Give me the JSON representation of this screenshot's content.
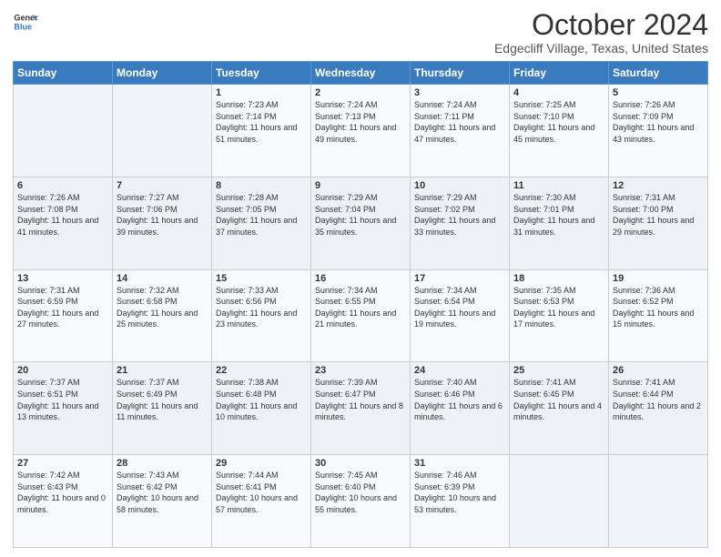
{
  "header": {
    "logo_line1": "General",
    "logo_line2": "Blue",
    "title": "October 2024",
    "subtitle": "Edgecliff Village, Texas, United States"
  },
  "days_of_week": [
    "Sunday",
    "Monday",
    "Tuesday",
    "Wednesday",
    "Thursday",
    "Friday",
    "Saturday"
  ],
  "weeks": [
    [
      {
        "day": "",
        "info": ""
      },
      {
        "day": "",
        "info": ""
      },
      {
        "day": "1",
        "info": "Sunrise: 7:23 AM\nSunset: 7:14 PM\nDaylight: 11 hours and 51 minutes."
      },
      {
        "day": "2",
        "info": "Sunrise: 7:24 AM\nSunset: 7:13 PM\nDaylight: 11 hours and 49 minutes."
      },
      {
        "day": "3",
        "info": "Sunrise: 7:24 AM\nSunset: 7:11 PM\nDaylight: 11 hours and 47 minutes."
      },
      {
        "day": "4",
        "info": "Sunrise: 7:25 AM\nSunset: 7:10 PM\nDaylight: 11 hours and 45 minutes."
      },
      {
        "day": "5",
        "info": "Sunrise: 7:26 AM\nSunset: 7:09 PM\nDaylight: 11 hours and 43 minutes."
      }
    ],
    [
      {
        "day": "6",
        "info": "Sunrise: 7:26 AM\nSunset: 7:08 PM\nDaylight: 11 hours and 41 minutes."
      },
      {
        "day": "7",
        "info": "Sunrise: 7:27 AM\nSunset: 7:06 PM\nDaylight: 11 hours and 39 minutes."
      },
      {
        "day": "8",
        "info": "Sunrise: 7:28 AM\nSunset: 7:05 PM\nDaylight: 11 hours and 37 minutes."
      },
      {
        "day": "9",
        "info": "Sunrise: 7:29 AM\nSunset: 7:04 PM\nDaylight: 11 hours and 35 minutes."
      },
      {
        "day": "10",
        "info": "Sunrise: 7:29 AM\nSunset: 7:02 PM\nDaylight: 11 hours and 33 minutes."
      },
      {
        "day": "11",
        "info": "Sunrise: 7:30 AM\nSunset: 7:01 PM\nDaylight: 11 hours and 31 minutes."
      },
      {
        "day": "12",
        "info": "Sunrise: 7:31 AM\nSunset: 7:00 PM\nDaylight: 11 hours and 29 minutes."
      }
    ],
    [
      {
        "day": "13",
        "info": "Sunrise: 7:31 AM\nSunset: 6:59 PM\nDaylight: 11 hours and 27 minutes."
      },
      {
        "day": "14",
        "info": "Sunrise: 7:32 AM\nSunset: 6:58 PM\nDaylight: 11 hours and 25 minutes."
      },
      {
        "day": "15",
        "info": "Sunrise: 7:33 AM\nSunset: 6:56 PM\nDaylight: 11 hours and 23 minutes."
      },
      {
        "day": "16",
        "info": "Sunrise: 7:34 AM\nSunset: 6:55 PM\nDaylight: 11 hours and 21 minutes."
      },
      {
        "day": "17",
        "info": "Sunrise: 7:34 AM\nSunset: 6:54 PM\nDaylight: 11 hours and 19 minutes."
      },
      {
        "day": "18",
        "info": "Sunrise: 7:35 AM\nSunset: 6:53 PM\nDaylight: 11 hours and 17 minutes."
      },
      {
        "day": "19",
        "info": "Sunrise: 7:36 AM\nSunset: 6:52 PM\nDaylight: 11 hours and 15 minutes."
      }
    ],
    [
      {
        "day": "20",
        "info": "Sunrise: 7:37 AM\nSunset: 6:51 PM\nDaylight: 11 hours and 13 minutes."
      },
      {
        "day": "21",
        "info": "Sunrise: 7:37 AM\nSunset: 6:49 PM\nDaylight: 11 hours and 11 minutes."
      },
      {
        "day": "22",
        "info": "Sunrise: 7:38 AM\nSunset: 6:48 PM\nDaylight: 11 hours and 10 minutes."
      },
      {
        "day": "23",
        "info": "Sunrise: 7:39 AM\nSunset: 6:47 PM\nDaylight: 11 hours and 8 minutes."
      },
      {
        "day": "24",
        "info": "Sunrise: 7:40 AM\nSunset: 6:46 PM\nDaylight: 11 hours and 6 minutes."
      },
      {
        "day": "25",
        "info": "Sunrise: 7:41 AM\nSunset: 6:45 PM\nDaylight: 11 hours and 4 minutes."
      },
      {
        "day": "26",
        "info": "Sunrise: 7:41 AM\nSunset: 6:44 PM\nDaylight: 11 hours and 2 minutes."
      }
    ],
    [
      {
        "day": "27",
        "info": "Sunrise: 7:42 AM\nSunset: 6:43 PM\nDaylight: 11 hours and 0 minutes."
      },
      {
        "day": "28",
        "info": "Sunrise: 7:43 AM\nSunset: 6:42 PM\nDaylight: 10 hours and 58 minutes."
      },
      {
        "day": "29",
        "info": "Sunrise: 7:44 AM\nSunset: 6:41 PM\nDaylight: 10 hours and 57 minutes."
      },
      {
        "day": "30",
        "info": "Sunrise: 7:45 AM\nSunset: 6:40 PM\nDaylight: 10 hours and 55 minutes."
      },
      {
        "day": "31",
        "info": "Sunrise: 7:46 AM\nSunset: 6:39 PM\nDaylight: 10 hours and 53 minutes."
      },
      {
        "day": "",
        "info": ""
      },
      {
        "day": "",
        "info": ""
      }
    ]
  ]
}
